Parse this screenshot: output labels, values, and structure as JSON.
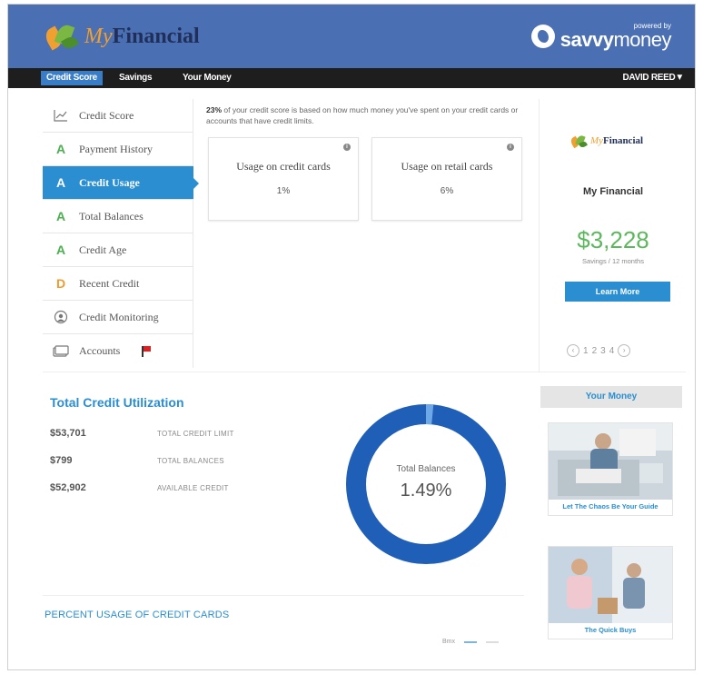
{
  "header": {
    "logo_prefix": "My",
    "logo_suffix": "Financial",
    "powered_small": "powered by",
    "powered_brand_bold": "savvy",
    "powered_brand_light": "money"
  },
  "nav": {
    "tabs": [
      "Credit Score",
      "Savings",
      "Your Money"
    ],
    "active_tab": "Credit Score",
    "user": "DAVID REED▼"
  },
  "sidebar": {
    "items": [
      {
        "grade": "",
        "icon": "chart-icon",
        "label": "Credit Score"
      },
      {
        "grade": "A",
        "label": "Payment History"
      },
      {
        "grade": "A",
        "label": "Credit Usage",
        "active": true
      },
      {
        "grade": "A",
        "label": "Total Balances"
      },
      {
        "grade": "A",
        "label": "Credit Age"
      },
      {
        "grade": "D",
        "label": "Recent Credit"
      },
      {
        "grade": "",
        "icon": "monitor-icon",
        "label": "Credit Monitoring"
      },
      {
        "grade": "",
        "icon": "accounts-icon",
        "label": "Accounts",
        "flagged": true
      }
    ]
  },
  "main": {
    "description_bold": "23%",
    "description_rest": " of your credit score is based on how much money you've spent on your credit cards or accounts that have credit limits.",
    "cards": [
      {
        "title": "Usage on credit cards",
        "value": "1%"
      },
      {
        "title": "Usage on retail cards",
        "value": "6%"
      }
    ]
  },
  "promo": {
    "logo_prefix": "My",
    "logo_suffix": "Financial",
    "name": "My Financial",
    "amount": "$3,228",
    "sub": "Savings / 12 months",
    "button": "Learn More",
    "pages": [
      "1",
      "2",
      "3",
      "4"
    ]
  },
  "utilization": {
    "title": "Total Credit Utilization",
    "stats": [
      {
        "value": "$53,701",
        "label": "TOTAL CREDIT LIMIT"
      },
      {
        "value": "$799",
        "label": "TOTAL BALANCES"
      },
      {
        "value": "$52,902",
        "label": "AVAILABLE CREDIT"
      }
    ],
    "donut_caption": "Total Balances",
    "donut_value": "1.49%",
    "donut_fraction": 0.0149,
    "colors": {
      "used": "#6fa8e6",
      "available": "#1f5fb8"
    }
  },
  "percent_usage": {
    "title": "PERCENT USAGE OF CREDIT CARDS",
    "legend": [
      "Bmx",
      "",
      ""
    ]
  },
  "your_money": {
    "title": "Your Money",
    "articles": [
      {
        "caption": "Let The Chaos Be Your Guide"
      },
      {
        "caption": "The Quick Buys"
      }
    ]
  },
  "colors": {
    "header_blue": "#4a6fb3",
    "accent": "#2a8ed0",
    "grade_a": "#4caf50",
    "grade_d": "#f29a2e",
    "savings_green": "#5cb85c"
  }
}
